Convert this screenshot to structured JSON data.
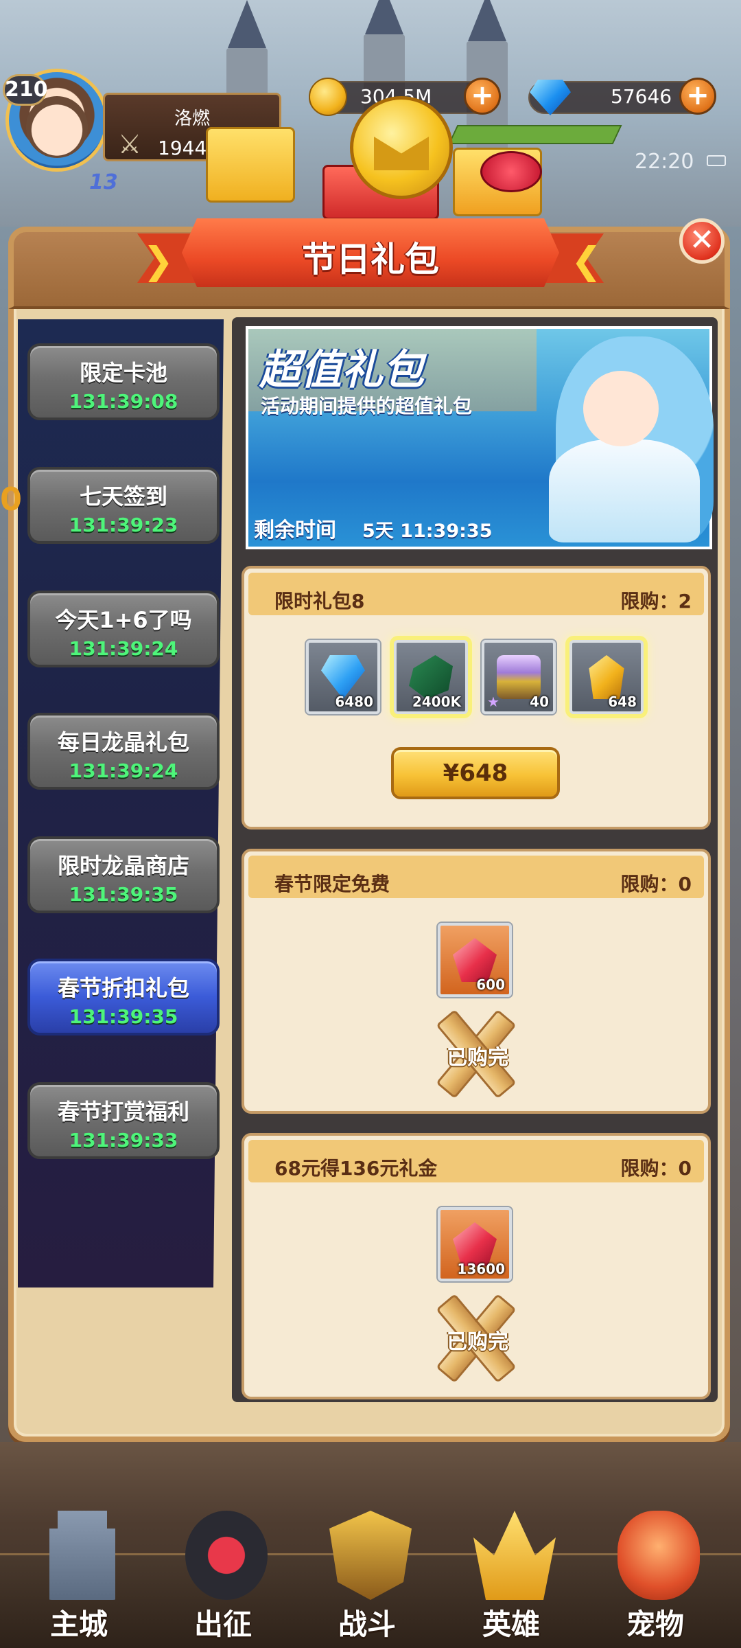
{
  "hud": {
    "level": "210",
    "vip": "13",
    "player_name": "洛燃",
    "power": "19443万",
    "gold": "304.5M",
    "gems": "57646",
    "time": "22:20",
    "gold_plus": "+",
    "gem_plus": "+"
  },
  "dialog": {
    "title": "节日礼包",
    "close_label": "✕"
  },
  "sidebar": {
    "items": [
      {
        "label": "限定卡池",
        "timer": "131:39:08"
      },
      {
        "label": "七天签到",
        "timer": "131:39:23"
      },
      {
        "label": "今天1+6了吗",
        "timer": "131:39:24"
      },
      {
        "label": "每日龙晶礼包",
        "timer": "131:39:24"
      },
      {
        "label": "限时龙晶商店",
        "timer": "131:39:35"
      },
      {
        "label": "春节折扣礼包",
        "timer": "131:39:35"
      },
      {
        "label": "春节打赏福利",
        "timer": "131:39:33"
      }
    ],
    "active_index": 5
  },
  "banner": {
    "title": "超值礼包",
    "subtitle": "活动期间提供的超值礼包",
    "time_label": "剩余时间",
    "time_value": "5天 11:39:35"
  },
  "packs": [
    {
      "title": "限时礼包8",
      "limit": "限购：2",
      "items": [
        {
          "icon": "blue-gem-icon",
          "count": "6480"
        },
        {
          "icon": "green-ore-icon",
          "count": "2400K"
        },
        {
          "icon": "treasure-chest-icon",
          "count": "40"
        },
        {
          "icon": "gold-crystal-icon",
          "count": "648"
        }
      ],
      "price": "¥648"
    },
    {
      "title": "春节限定免费",
      "limit": "限购：0",
      "items": [
        {
          "icon": "red-gem-icon",
          "count": "600"
        }
      ],
      "status": "已购完"
    },
    {
      "title": "68元得136元礼金",
      "limit": "限购：0",
      "items": [
        {
          "icon": "red-gem-icon",
          "count": "13600"
        }
      ],
      "status": "已购完"
    }
  ],
  "nav": [
    {
      "label": "主城",
      "icon": "castle-tower-icon"
    },
    {
      "label": "出征",
      "icon": "expedition-icon"
    },
    {
      "label": "战斗",
      "icon": "battle-shield-icon"
    },
    {
      "label": "英雄",
      "icon": "hero-crown-icon"
    },
    {
      "label": "宠物",
      "icon": "dragon-pet-icon"
    }
  ],
  "colors": {
    "timer_green": "#4ef57a",
    "active_tab": "#3b5bd8",
    "ribbon_red": "#ec4a26",
    "card_header": "#f1c877",
    "button_gold": "#f7c236"
  }
}
